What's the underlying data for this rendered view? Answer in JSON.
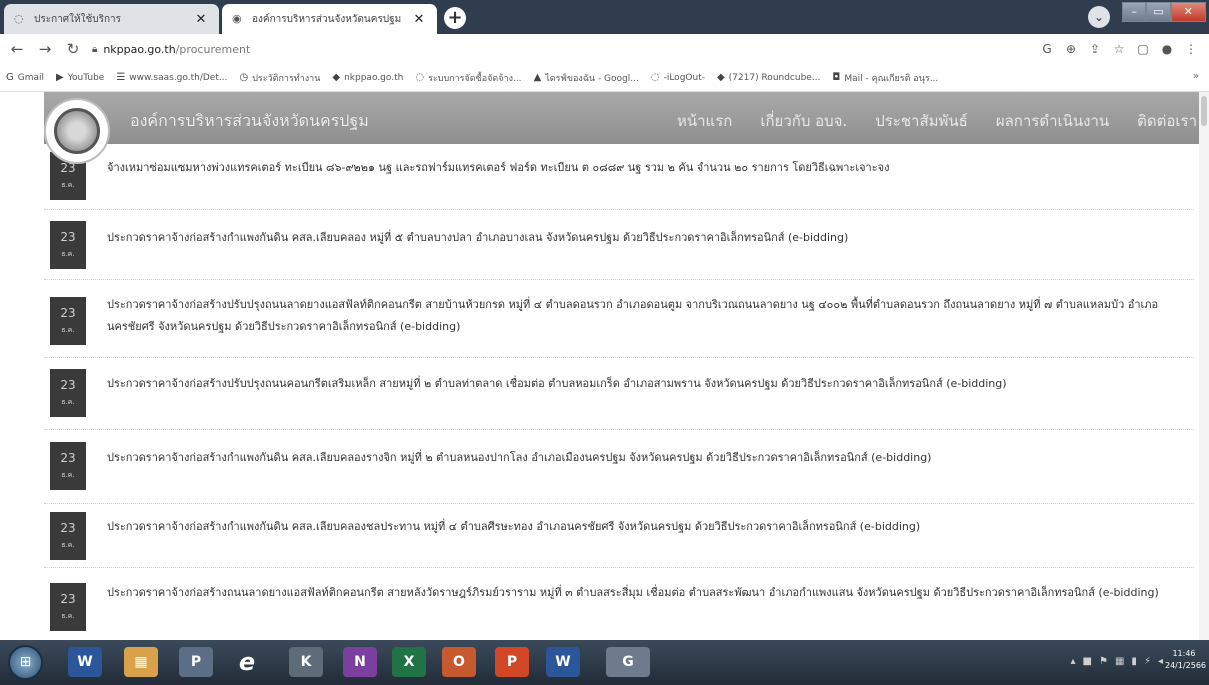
{
  "browser": {
    "tabs": [
      {
        "title": "ประกาศให้ใช้บริการ",
        "icon": "page-icon",
        "close": "✕"
      },
      {
        "title": "องค์การบริหารส่วนจังหวัดนครปฐม",
        "icon": "globe-icon",
        "close": "✕"
      }
    ],
    "new_tab": "+",
    "address": {
      "host": "nkppao.go.th",
      "path": "/procurement"
    },
    "bookmarks": [
      {
        "label": "Gmail",
        "icon": "G"
      },
      {
        "label": "YouTube",
        "icon": "▶"
      },
      {
        "label": "www.saas.go.th/Det...",
        "icon": "☰"
      },
      {
        "label": "ประวัติการทำงาน",
        "icon": "◷"
      },
      {
        "label": "nkppao.go.th",
        "icon": "◆"
      },
      {
        "label": "ระบบการจัดซื้อจัดจ้าง...",
        "icon": "◌"
      },
      {
        "label": "ไดรฟ์ของฉัน - Googl...",
        "icon": "▲"
      },
      {
        "label": "-iLogOut-",
        "icon": "◌"
      },
      {
        "label": "(7217) Roundcube...",
        "icon": "◆"
      },
      {
        "label": "Mail - คุณเกียรติ อนุร...",
        "icon": "◘"
      }
    ]
  },
  "site": {
    "title": "องค์การบริหารส่วนจังหวัดนครปฐม",
    "nav": [
      "หน้าแรก",
      "เกี่ยวกับ อบจ.",
      "ประชาสัมพันธ์",
      "ผลการดำเนินงาน",
      "ติดต่อเรา"
    ]
  },
  "items": [
    {
      "day": "23",
      "month": "ธ.ค.",
      "title": "จ้างเหมาซ่อมแซมหางพ่วงแทรคเตอร์ ทะเบียน ๘๖-๙๒๒๑ นฐ และรถฟาร์มแทรคเตอร์ ฟอร์ด ทะเบียน ต ๐๘๘๙ นฐ รวม ๒ คัน จำนวน ๒๐ รายการ โดยวิธีเฉพาะเจาะจง"
    },
    {
      "day": "23",
      "month": "ธ.ค.",
      "title": "ประกวดราคาจ้างก่อสร้างกำแพงกันดิน คสล.เลียบคลอง หมู่ที่ ๕ ตำบลบางปลา อำเภอบางเลน จังหวัดนครปฐม ด้วยวิธีประกวดราคาอิเล็กทรอนิกส์ (e-bidding)"
    },
    {
      "day": "23",
      "month": "ธ.ค.",
      "title": "ประกวดราคาจ้างก่อสร้างปรับปรุงถนนลาดยางแอสฟัลท์ติกคอนกรีต สายบ้านห้วยกรด หมู่ที่ ๔ ตำบลดอนรวก อำเภอดอนตูม จากบริเวณถนนลาดยาง นฐ ๔๐๐๒ พื้นที่ตำบลดอนรวก ถึงถนนลาดยาง หมู่ที่ ๗ ตำบลแหลมบัว อำเภอนครชัยศรี จังหวัดนครปฐม ด้วยวิธีประกวดราคาอิเล็กทรอนิกส์ (e-bidding)"
    },
    {
      "day": "23",
      "month": "ธ.ค.",
      "title": "ประกวดราคาจ้างก่อสร้างปรับปรุงถนนคอนกรีตเสริมเหล็ก สายหมู่ที่ ๒ ตำบลท่าตลาด เชื่อมต่อ ตำบลหอมเกร็ด อำเภอสามพราน จังหวัดนครปฐม ด้วยวิธีประกวดราคาอิเล็กทรอนิกส์ (e-bidding)"
    },
    {
      "day": "23",
      "month": "ธ.ค.",
      "title": "ประกวดราคาจ้างก่อสร้างกำแพงกันดิน คสล.เลียบคลองรางจิก หมู่ที่ ๒ ตำบลหนองปากโลง อำเภอเมืองนครปฐม จังหวัดนครปฐม ด้วยวิธีประกวดราคาอิเล็กทรอนิกส์ (e-bidding)"
    },
    {
      "day": "23",
      "month": "ธ.ค.",
      "title": "ประกวดราคาจ้างก่อสร้างกำแพงกันดิน คสล.เลียบคลองชลประทาน หมู่ที่ ๔ ตำบลศีรษะทอง อำเภอนครชัยศรี จังหวัดนครปฐม ด้วยวิธีประกวดราคาอิเล็กทรอนิกส์ (e-bidding)"
    },
    {
      "day": "23",
      "month": "ธ.ค.",
      "title": "ประกวดราคาจ้างก่อสร้างถนนลาดยางแอสฟัลท์ติกคอนกรีต สายหลังวัดราษฎร์ภิรมย์วราราม หมู่ที่ ๓ ตำบลสระสี่มุม เชื่อมต่อ ตำบลสระพัฒนา อำเภอกำแพงแสน จังหวัดนครปฐม ด้วยวิธีประกวดราคาอิเล็กทรอนิกส์ (e-bidding)"
    }
  ],
  "taskbar": {
    "apps": [
      "W",
      "▦",
      "P",
      "e",
      "K",
      "N",
      "X",
      "O",
      "P",
      "W",
      "G"
    ],
    "clock_time": "11:46",
    "clock_date": "24/1/2566"
  }
}
